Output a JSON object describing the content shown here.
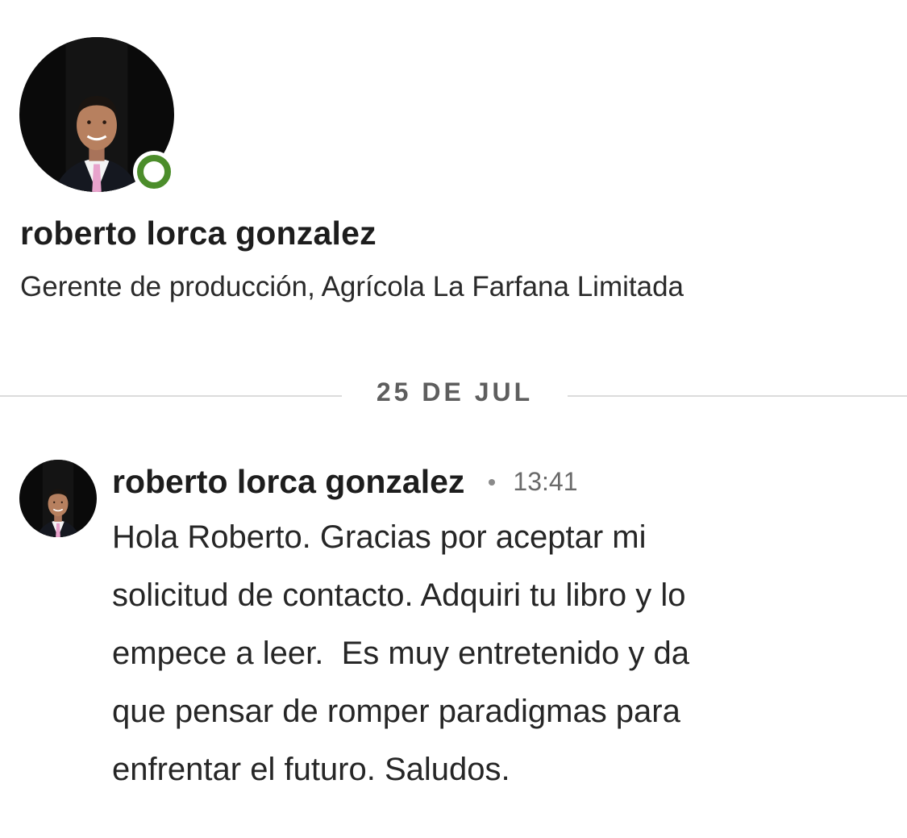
{
  "profile": {
    "name": "roberto lorca gonzalez",
    "headline": "Gerente de producción, Agrícola La Farfana Limitada",
    "presence": "online",
    "presence_color": "#4c8d2b",
    "avatar_icon": "profile-photo"
  },
  "divider": {
    "date_label": "25 DE JUL"
  },
  "message": {
    "sender": "roberto lorca gonzalez",
    "time": "13:41",
    "body_lines": [
      "Hola Roberto. Gracias por aceptar mi",
      "solicitud de contacto. Adquiri tu libro y lo",
      "empece a leer.  Es muy entretenido y da",
      "que pensar de romper paradigmas para",
      "enfrentar el futuro. Saludos."
    ]
  }
}
